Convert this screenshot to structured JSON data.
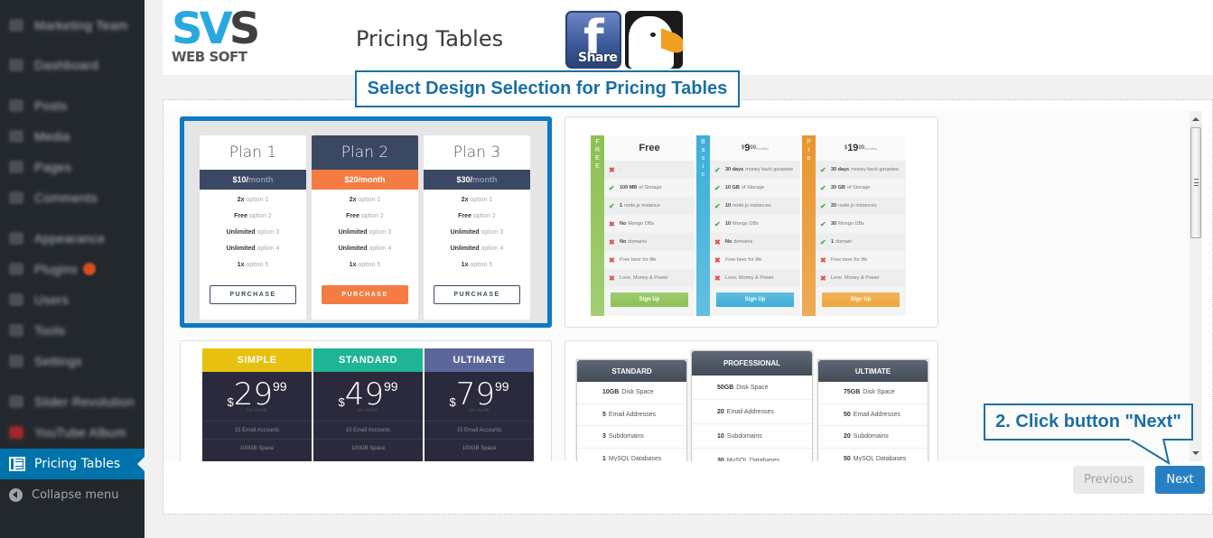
{
  "sidebar": {
    "items": [
      {
        "label": "Marketing Team",
        "icon": "user-group-icon"
      },
      {
        "label": "Dashboard",
        "icon": "dashboard-icon"
      },
      {
        "label": "Posts",
        "icon": "pin-icon"
      },
      {
        "label": "Media",
        "icon": "media-icon"
      },
      {
        "label": "Pages",
        "icon": "page-icon"
      },
      {
        "label": "Comments",
        "icon": "comment-icon"
      },
      {
        "label": "Appearance",
        "icon": "brush-icon"
      },
      {
        "label": "Plugins",
        "icon": "plugin-icon",
        "badge": true
      },
      {
        "label": "Users",
        "icon": "user-icon"
      },
      {
        "label": "Tools",
        "icon": "wrench-icon"
      },
      {
        "label": "Settings",
        "icon": "settings-icon"
      },
      {
        "label": "Slider Revolution",
        "icon": "refresh-icon"
      },
      {
        "label": "YouTube Album",
        "icon": "youtube-icon"
      }
    ],
    "active": {
      "label": "Pricing Tables",
      "icon": "list-icon"
    },
    "collapse": {
      "label": "Collapse menu",
      "icon": "collapse-arrow-icon"
    }
  },
  "header": {
    "logo_top": [
      "SV",
      "S"
    ],
    "logo_bottom": "WEB SOFT",
    "title": "Pricing Tables",
    "facebook_share_f": "f",
    "facebook_share_label": "Share"
  },
  "callouts": {
    "step1": "Select Design Selection for Pricing Tables",
    "step2": "2. Click button \"Next\""
  },
  "designs": {
    "design1": {
      "selected": true,
      "plans": [
        {
          "name": "Plan 1",
          "price": "$10/",
          "period": "month",
          "featured": false
        },
        {
          "name": "Plan 2",
          "price": "$20/",
          "period": "month",
          "featured": true
        },
        {
          "name": "Plan 3",
          "price": "$30/",
          "period": "month",
          "featured": false
        }
      ],
      "options": [
        {
          "bold": "2x",
          "text": "option 1"
        },
        {
          "bold": "Free",
          "text": "option 2"
        },
        {
          "bold": "Unlimited",
          "text": "option 3"
        },
        {
          "bold": "Unlimited",
          "text": "option 4"
        },
        {
          "bold": "1x",
          "text": "option 5"
        }
      ],
      "button": "PURCHASE"
    },
    "design2": {
      "selected": false,
      "plans": [
        {
          "side": "FREE",
          "color": "#8cc152",
          "btn_color": "#8cc152",
          "head": {
            "type": "text",
            "text": "Free"
          },
          "rows": [
            {
              "ok": false,
              "bold": "",
              "text": "-"
            },
            {
              "ok": true,
              "bold": "100 MB",
              "text": "of Storage"
            },
            {
              "ok": true,
              "bold": "1",
              "text": "node.js instance"
            },
            {
              "ok": false,
              "bold": "No",
              "text": "Mongo DBs"
            },
            {
              "ok": false,
              "bold": "No",
              "text": "domains"
            },
            {
              "ok": false,
              "bold": "",
              "text": "Free beer for life"
            },
            {
              "ok": false,
              "bold": "",
              "text": "Love, Money & Power"
            }
          ]
        },
        {
          "side": "Basic",
          "color": "#3bafda",
          "btn_color": "#3bafda",
          "head": {
            "type": "price",
            "cur": "$",
            "amt": "9",
            "cents": "99",
            "per": "monthly"
          },
          "rows": [
            {
              "ok": true,
              "bold": "30 days",
              "text": "money back garantee"
            },
            {
              "ok": true,
              "bold": "10 GB",
              "text": "of Storage"
            },
            {
              "ok": true,
              "bold": "10",
              "text": "node.js instances"
            },
            {
              "ok": true,
              "bold": "10",
              "text": "Mongo DBs"
            },
            {
              "ok": false,
              "bold": "No",
              "text": "domains"
            },
            {
              "ok": false,
              "bold": "",
              "text": "Free beer for life"
            },
            {
              "ok": false,
              "bold": "",
              "text": "Love, Money & Power"
            }
          ]
        },
        {
          "side": "Pro",
          "color": "#e8962e",
          "btn_color": "#f0a537",
          "head": {
            "type": "price",
            "cur": "$",
            "amt": "19",
            "cents": "99",
            "per": "monthly"
          },
          "rows": [
            {
              "ok": true,
              "bold": "30 days",
              "text": "money back garantee"
            },
            {
              "ok": true,
              "bold": "20 GB",
              "text": "of Storage"
            },
            {
              "ok": true,
              "bold": "20",
              "text": "node.js instances"
            },
            {
              "ok": true,
              "bold": "30",
              "text": "Mongo DBs"
            },
            {
              "ok": true,
              "bold": "1",
              "text": "domain"
            },
            {
              "ok": false,
              "bold": "",
              "text": "Free beer for life"
            },
            {
              "ok": false,
              "bold": "",
              "text": "Love, Money & Power"
            }
          ]
        }
      ],
      "button": "Sign Up"
    },
    "design3": {
      "selected": false,
      "plans": [
        {
          "name": "SIMPLE",
          "color": "#e6c10f",
          "cur": "$",
          "amt": "29",
          "cents": "99",
          "per": "per month",
          "rows": [
            "15 Email Accounts",
            "100GB Space"
          ]
        },
        {
          "name": "STANDARD",
          "color": "#1fb594",
          "cur": "$",
          "amt": "49",
          "cents": "99",
          "per": "per month",
          "rows": [
            "15 Email Accounts",
            "100GB Space"
          ]
        },
        {
          "name": "ULTIMATE",
          "color": "#5a6699",
          "cur": "$",
          "amt": "79",
          "cents": "99",
          "per": "per month",
          "rows": [
            "15 Email Accounts",
            "100GB Space"
          ]
        }
      ]
    },
    "design4": {
      "selected": false,
      "plans": [
        {
          "name": "STANDARD",
          "featured": false,
          "rows": [
            {
              "bold": "10GB",
              "text": "Disk Space"
            },
            {
              "bold": "5",
              "text": "Email Addresses"
            },
            {
              "bold": "3",
              "text": "Subdomains"
            },
            {
              "bold": "1",
              "text": "MySQL Databases"
            }
          ]
        },
        {
          "name": "PROFESSIONAL",
          "featured": true,
          "rows": [
            {
              "bold": "50GB",
              "text": "Disk Space"
            },
            {
              "bold": "20",
              "text": "Email Addresses"
            },
            {
              "bold": "10",
              "text": "Subdomains"
            },
            {
              "bold": "30",
              "text": "MySQL Databases"
            }
          ]
        },
        {
          "name": "ULTIMATE",
          "featured": false,
          "rows": [
            {
              "bold": "75GB",
              "text": "Disk Space"
            },
            {
              "bold": "50",
              "text": "Email Addresses"
            },
            {
              "bold": "20",
              "text": "Subdomains"
            },
            {
              "bold": "50",
              "text": "MySQL Databases"
            }
          ]
        }
      ]
    }
  },
  "buttons": {
    "previous": "Previous",
    "next": "Next",
    "previous_disabled": true
  },
  "colors": {
    "accent": "#0073aa",
    "selection_border": "#0e7ac3",
    "callout": "#1a6fa4",
    "next_button": "#2780c4"
  }
}
